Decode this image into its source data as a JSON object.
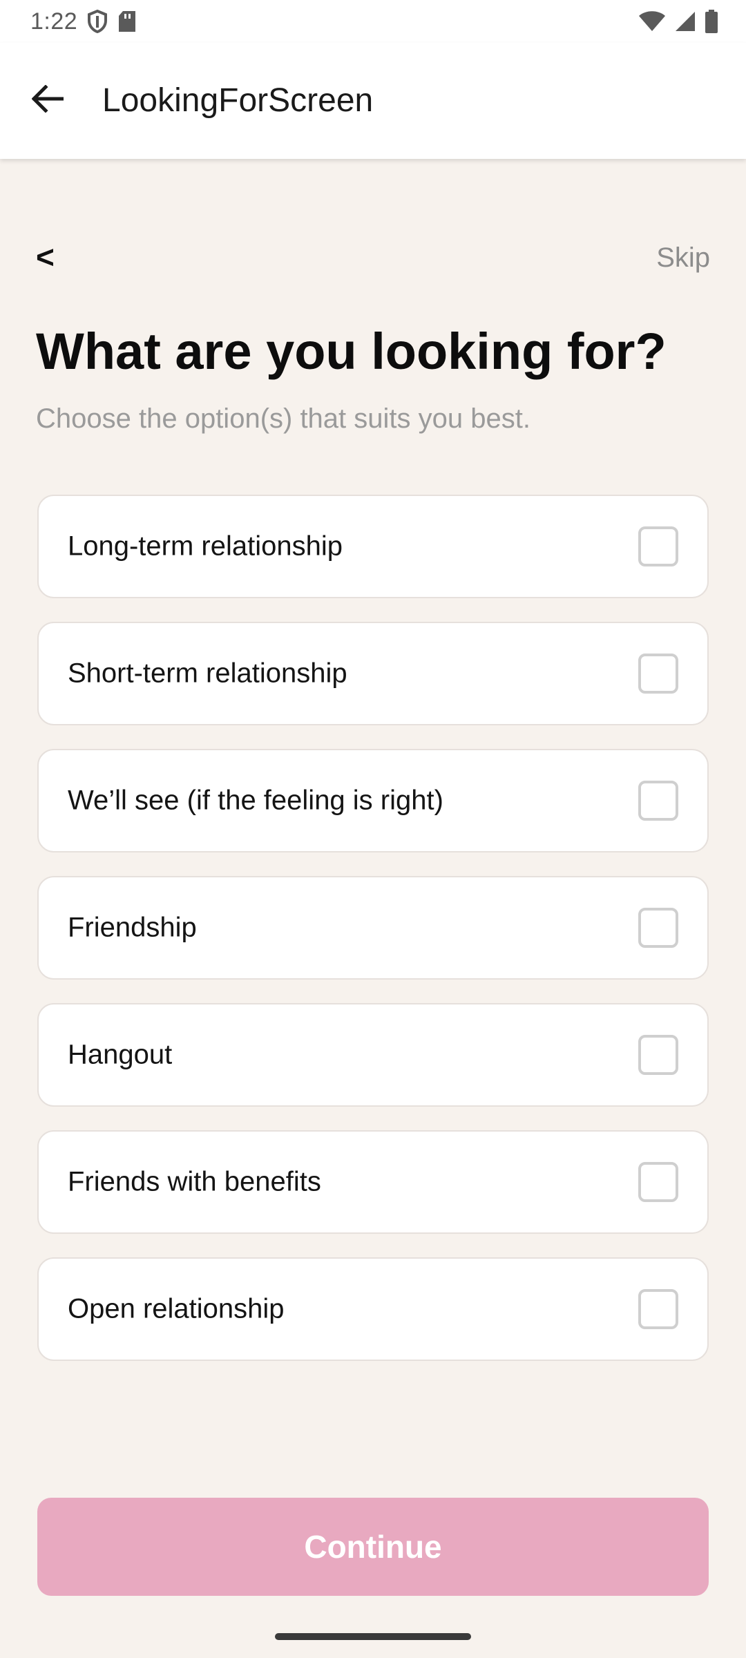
{
  "status_bar": {
    "time": "1:22",
    "left_icons": [
      "shield-icon",
      "sd-card-icon"
    ],
    "right_icons": [
      "wifi-icon",
      "signal-icon",
      "battery-icon"
    ]
  },
  "app_bar": {
    "back_icon": "arrow-left-icon",
    "title": "LookingForScreen"
  },
  "nav": {
    "back_label": "<",
    "skip_label": "Skip"
  },
  "heading": "What are you looking for?",
  "subheading": "Choose the option(s) that suits you best.",
  "options": [
    {
      "label": "Long-term relationship",
      "checked": false
    },
    {
      "label": "Short-term relationship",
      "checked": false
    },
    {
      "label": "We’ll see (if the feeling is right)",
      "checked": false
    },
    {
      "label": "Friendship",
      "checked": false
    },
    {
      "label": "Hangout",
      "checked": false
    },
    {
      "label": "Friends with benefits",
      "checked": false
    },
    {
      "label": "Open relationship",
      "checked": false
    }
  ],
  "continue_label": "Continue",
  "colors": {
    "background": "#f7f2ed",
    "continue_disabled": "#e8a9c0",
    "skip_text": "#8c8c8c",
    "subheading_text": "#9a9a9a"
  }
}
